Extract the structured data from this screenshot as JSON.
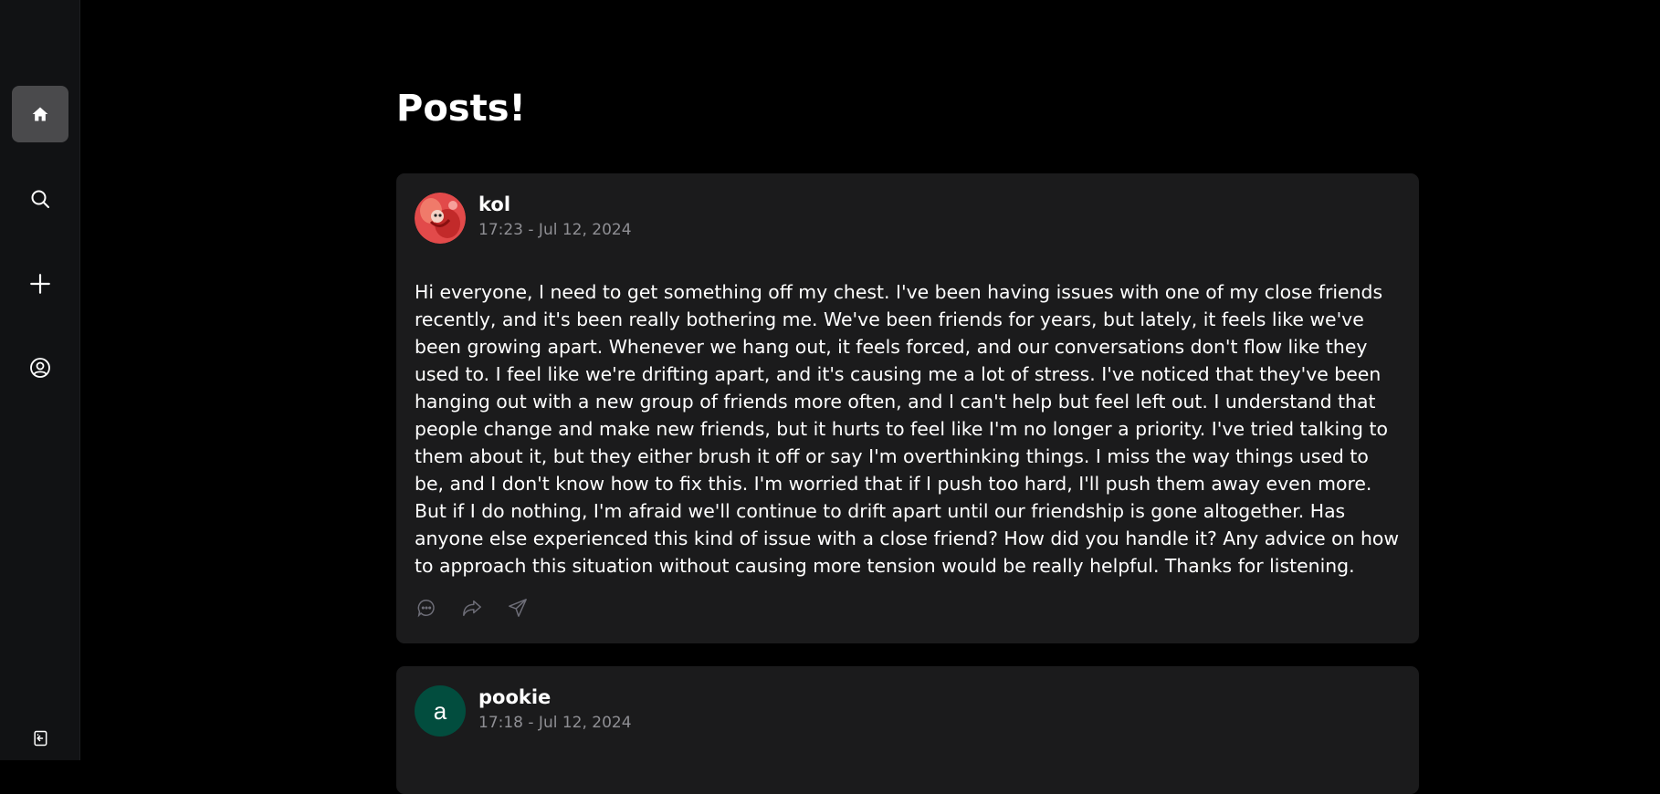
{
  "sidebar": {
    "items": [
      {
        "icon": "home-icon",
        "active": true
      },
      {
        "icon": "search-icon",
        "active": false
      },
      {
        "icon": "plus-icon",
        "active": false
      },
      {
        "icon": "user-circle-icon",
        "active": false
      }
    ],
    "bottom_icon": "logout-icon"
  },
  "page": {
    "title": "Posts!"
  },
  "posts": [
    {
      "author": "kol",
      "timestamp": "17:23 - Jul 12, 2024",
      "avatar_type": "image",
      "body": "Hi everyone, I need to get something off my chest. I've been having issues with one of my close friends recently, and it's been really bothering me. We've been friends for years, but lately, it feels like we've been growing apart. Whenever we hang out, it feels forced, and our conversations don't flow like they used to. I feel like we're drifting apart, and it's causing me a lot of stress. I've noticed that they've been hanging out with a new group of friends more often, and I can't help but feel left out. I understand that people change and make new friends, but it hurts to feel like I'm no longer a priority. I've tried talking to them about it, but they either brush it off or say I'm overthinking things. I miss the way things used to be, and I don't know how to fix this. I'm worried that if I push too hard, I'll push them away even more. But if I do nothing, I'm afraid we'll continue to drift apart until our friendship is gone altogether. Has anyone else experienced this kind of issue with a close friend? How did you handle it? Any advice on how to approach this situation without causing more tension would be really helpful. Thanks for listening.",
      "actions": [
        "comment-icon",
        "share-icon",
        "send-icon"
      ]
    },
    {
      "author": "pookie",
      "timestamp": "17:18 - Jul 12, 2024",
      "avatar_type": "letter",
      "avatar_letter": "a",
      "avatar_color": "#024d3e"
    }
  ],
  "colors": {
    "background": "#000000",
    "sidebar": "#111214",
    "card": "#1b1b1c",
    "active_nav": "#4a4a4c",
    "muted_text": "#8f8f94",
    "action_icon": "#6e6e78"
  }
}
